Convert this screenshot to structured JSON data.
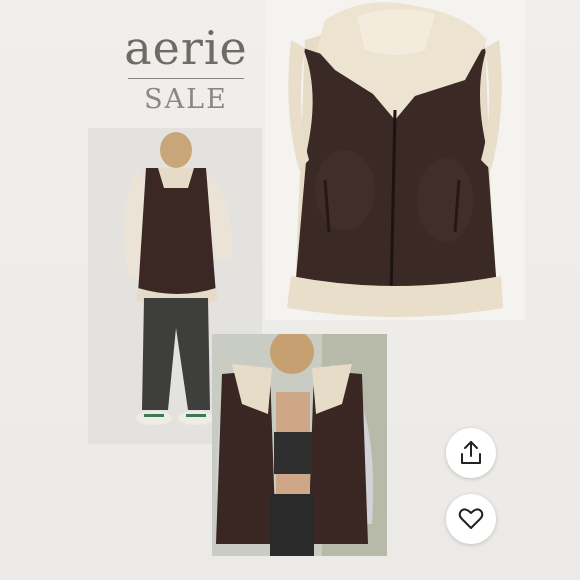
{
  "brand": {
    "logo_text": "aerie",
    "sale_text": "SALE"
  },
  "images": {
    "vest": "faux-leather-sherpa-vest",
    "model_left": "model-wearing-vest-full-body",
    "model_right": "model-wearing-vest-closeup"
  },
  "actions": {
    "share_icon": "share-icon",
    "like_icon": "heart-icon"
  },
  "colors": {
    "vest_brown": "#3a2824",
    "sherpa_cream": "#e9dfcc",
    "background": "#eeece8"
  }
}
